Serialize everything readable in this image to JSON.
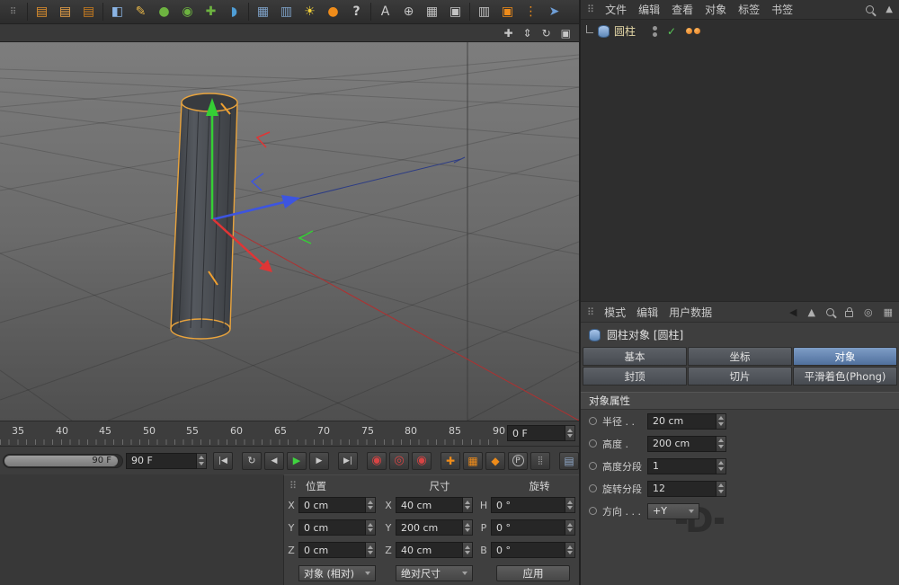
{
  "colors": {
    "accent_orange": "#ef8c1a",
    "axis_x_red": "#e03535",
    "axis_y_green": "#35cf35",
    "axis_z_blue": "#3d55e0",
    "selection_outline_orange": "#e8a33d",
    "tab_active_blue": "#5f7fa6",
    "play_green": "#3fd43f",
    "record_red": "#d84444"
  },
  "toolbar": {
    "icons": [
      {
        "name": "grip-handle",
        "glyph": "⠿",
        "color": "#8a8a8a"
      },
      {
        "name": "render-view",
        "glyph": "▤",
        "color": "#e2922e"
      },
      {
        "name": "render-picture-viewer",
        "glyph": "▤",
        "color": "#eca448"
      },
      {
        "name": "edit-render-settings",
        "glyph": "▤",
        "color": "#cd7f1f"
      },
      {
        "name": "cube-primitive",
        "glyph": "◧",
        "color": "#8ab4e4"
      },
      {
        "name": "pen-tool",
        "glyph": "✎",
        "color": "#e7b648"
      },
      {
        "name": "subdivision-surface",
        "glyph": "●",
        "color": "#6db340"
      },
      {
        "name": "generator-sphere",
        "glyph": "◉",
        "color": "#6db340"
      },
      {
        "name": "modeling-add",
        "glyph": "✚",
        "color": "#6db340"
      },
      {
        "name": "volume-drop",
        "glyph": "◗",
        "color": "#4f9ed6"
      },
      {
        "name": "array-generator",
        "glyph": "▦",
        "color": "#7da0c6"
      },
      {
        "name": "instance-generator",
        "glyph": "▥",
        "color": "#7da0c6"
      },
      {
        "name": "light-tool",
        "glyph": "☀",
        "color": "#f2d13a"
      },
      {
        "name": "sky-sphere",
        "glyph": "●",
        "color": "#ef8c1a"
      },
      {
        "name": "help",
        "glyph": "?",
        "color": "#cccccc"
      },
      {
        "name": "text-tool",
        "glyph": "A",
        "color": "#cccccc"
      },
      {
        "name": "axis-mode",
        "glyph": "⊕",
        "color": "#c2c2c2"
      },
      {
        "name": "grid-snap",
        "glyph": "▦",
        "color": "#c2c2c2"
      },
      {
        "name": "workplane",
        "glyph": "▣",
        "color": "#c2c2c2"
      },
      {
        "name": "film-view",
        "glyph": "▥",
        "color": "#c2c2c2"
      },
      {
        "name": "display-screen",
        "glyph": "▣",
        "color": "#ef8c1a"
      },
      {
        "name": "menu-dots",
        "glyph": "⋮",
        "color": "#ef8c1a"
      },
      {
        "name": "feather-tool",
        "glyph": "➤",
        "color": "#6f9ed6"
      }
    ]
  },
  "menu": {
    "items": [
      "文件",
      "编辑",
      "查看",
      "对象",
      "标签",
      "书签"
    ],
    "up_icon": "▲"
  },
  "viewport": {
    "header_icons": [
      {
        "name": "pan-view-icon",
        "glyph": "✚"
      },
      {
        "name": "zoom-view-icon",
        "glyph": "⇕"
      },
      {
        "name": "rotate-view-icon",
        "glyph": "↻"
      },
      {
        "name": "toggle-views-icon",
        "glyph": "▣"
      }
    ]
  },
  "object_manager": {
    "object_label": "圆柱",
    "enable_check": "✓"
  },
  "timeline": {
    "ticks": [
      "35",
      "40",
      "45",
      "50",
      "55",
      "60",
      "65",
      "70",
      "75",
      "80",
      "85",
      "90"
    ],
    "end_field": "0 F"
  },
  "transport": {
    "slider_value": "90 F",
    "frame_value": "90 F",
    "buttons": [
      {
        "name": "goto-start",
        "glyph": "|◀"
      },
      {
        "name": "play-cycle",
        "glyph": "↻"
      },
      {
        "name": "prev-frame",
        "glyph": "◀"
      },
      {
        "name": "play",
        "glyph": "▶"
      },
      {
        "name": "next-frame",
        "glyph": "▶"
      },
      {
        "name": "goto-end",
        "glyph": "▶|"
      }
    ],
    "records": [
      {
        "name": "record-keyframe",
        "glyph": "◉"
      },
      {
        "name": "autokey",
        "glyph": "◎"
      },
      {
        "name": "record-options",
        "glyph": "◉"
      }
    ],
    "keys": [
      {
        "name": "key-position",
        "glyph": "✚"
      },
      {
        "name": "key-scale",
        "glyph": "▦"
      },
      {
        "name": "key-rotation",
        "glyph": "◆"
      },
      {
        "name": "key-parameter",
        "glyph": "P"
      },
      {
        "name": "key-pla",
        "glyph": "⣿"
      }
    ],
    "key_panel_glyph": "▤"
  },
  "coords": {
    "position_header": "位置",
    "size_header": "尺寸",
    "rotation_header": "旋转",
    "rows": [
      {
        "axis": "X",
        "position": "0 cm",
        "size_axis": "X",
        "size": "40 cm",
        "rot_axis": "H",
        "rotation": "0 °"
      },
      {
        "axis": "Y",
        "position": "0 cm",
        "size_axis": "Y",
        "size": "200 cm",
        "rot_axis": "P",
        "rotation": "0 °"
      },
      {
        "axis": "Z",
        "position": "0 cm",
        "size_axis": "Z",
        "size": "40 cm",
        "rot_axis": "B",
        "rotation": "0 °"
      }
    ],
    "mode_dropdown": "对象 (相对)",
    "size_dropdown": "绝对尺寸",
    "apply_button": "应用"
  },
  "attributes": {
    "menu": [
      "模式",
      "编辑",
      "用户数据"
    ],
    "title": "圆柱对象 [圆柱]",
    "tabs_row1": [
      "基本",
      "坐标",
      "对象"
    ],
    "active_tab": "对象",
    "tabs_row2": [
      "封顶",
      "切片",
      "平滑着色(Phong)"
    ],
    "section": "对象属性",
    "rows": [
      {
        "name": "radius",
        "label": "半径 . .",
        "value": "20 cm",
        "control": "number"
      },
      {
        "name": "height",
        "label": "高度 .",
        "value": "200 cm",
        "control": "number"
      },
      {
        "name": "height-segments",
        "label": "高度分段",
        "value": "1",
        "control": "number"
      },
      {
        "name": "rotation-segments",
        "label": "旋转分段",
        "value": "12",
        "control": "number"
      },
      {
        "name": "orientation",
        "label": "方向 . . .",
        "value": "+Y",
        "control": "dropdown"
      }
    ]
  },
  "watermark": "D"
}
